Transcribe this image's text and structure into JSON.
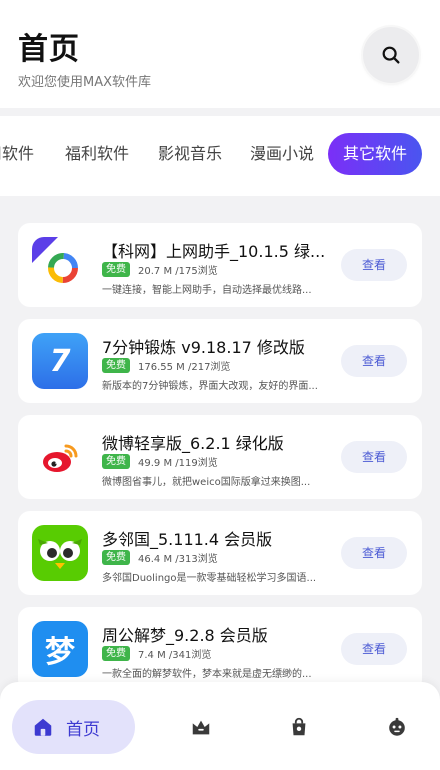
{
  "header": {
    "title": "首页",
    "subtitle": "欢迎您使用MAX软件库",
    "search_icon": "search-icon"
  },
  "tabs": [
    {
      "label": "用软件",
      "active": false
    },
    {
      "label": "福利软件",
      "active": false
    },
    {
      "label": "影视音乐",
      "active": false
    },
    {
      "label": "漫画小说",
      "active": false
    },
    {
      "label": "其它软件",
      "active": true
    }
  ],
  "apps": [
    {
      "name": "【科网】上网助手_10.1.5 绿...",
      "badge": "免费",
      "stats": "20.7 M /175浏览",
      "desc": "一键连接，智能上网助手，自动选择最优线路...",
      "button": "查看",
      "icon": "wifi-assistant-icon"
    },
    {
      "name": "7分钟锻炼 v9.18.17 修改版",
      "badge": "免费",
      "stats": "176.55 M /217浏览",
      "desc": "新版本的7分钟锻炼，界面大改观，友好的界面...",
      "button": "查看",
      "icon": "workout-7-icon"
    },
    {
      "name": "微博轻享版_6.2.1 绿化版",
      "badge": "免费",
      "stats": "49.9 M /119浏览",
      "desc": "微博图省事儿，就把weico国际版拿过来换图...",
      "button": "查看",
      "icon": "weibo-icon"
    },
    {
      "name": "多邻国_5.111.4 会员版",
      "badge": "免费",
      "stats": "46.4 M /313浏览",
      "desc": "多邻国Duolingo是一款零基础轻松学习多国语...",
      "button": "查看",
      "icon": "duolingo-owl-icon"
    },
    {
      "name": "周公解梦_9.2.8 会员版",
      "badge": "免费",
      "stats": "7.4 M /341浏览",
      "desc": "一款全面的解梦软件，梦本来就是虚无缥缈的...",
      "button": "查看",
      "icon": "dream-icon",
      "icon_text": "梦"
    }
  ],
  "icon_text": {
    "workout": "7"
  },
  "bottom_nav": {
    "home_label": "首页",
    "items": [
      "home-icon",
      "crown-icon",
      "bag-icon",
      "robot-icon"
    ]
  },
  "colors": {
    "accent_start": "#7b2ff7",
    "accent_end": "#4a55f0",
    "badge_green": "#3fb54a",
    "nav_active_bg": "#e3e2fb",
    "nav_active_text": "#3d3ad1"
  }
}
